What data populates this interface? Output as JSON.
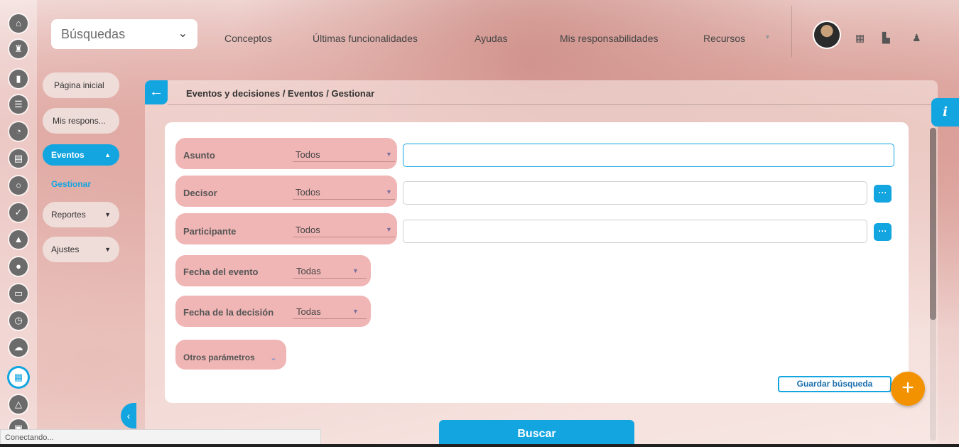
{
  "topnav": {
    "search_select": "Búsquedas",
    "links": [
      "Conceptos",
      "Últimas funcionalidades",
      "Ayudas",
      "Mis responsabilidades",
      "Recursos"
    ]
  },
  "rail_icons": [
    "home-icon",
    "tower-icon",
    "bar-chart-icon",
    "list-icon",
    "pie-chart-icon",
    "document-icon",
    "cycle-icon",
    "check-icon",
    "warning-icon",
    "toggle-icon",
    "monitor-icon",
    "clock-icon",
    "cloud-icon",
    "calendar-icon",
    "network-icon",
    "calculator-icon"
  ],
  "subnav": {
    "home": "Página inicial",
    "responsibilities": "Mis respons...",
    "events": "Eventos",
    "manage": "Gestionar",
    "reports": "Reportes",
    "settings": "Ajustes"
  },
  "breadcrumb": "Eventos y decisiones / Eventos / Gestionar",
  "info_label": "i",
  "filters": {
    "subject": {
      "label": "Asunto",
      "value": "Todos"
    },
    "decider": {
      "label": "Decisor",
      "value": "Todos"
    },
    "participant": {
      "label": "Participante",
      "value": "Todos"
    },
    "event_date": {
      "label": "Fecha del evento",
      "value": "Todas"
    },
    "decision_date": {
      "label": "Fecha de la decisión",
      "value": "Todas"
    },
    "other": {
      "label": "Otros parámetros"
    }
  },
  "dots_label": "···",
  "save_search": "Guardar búsqueda",
  "add_label": "+",
  "search_button": "Buscar",
  "status_text": "Conectando..."
}
